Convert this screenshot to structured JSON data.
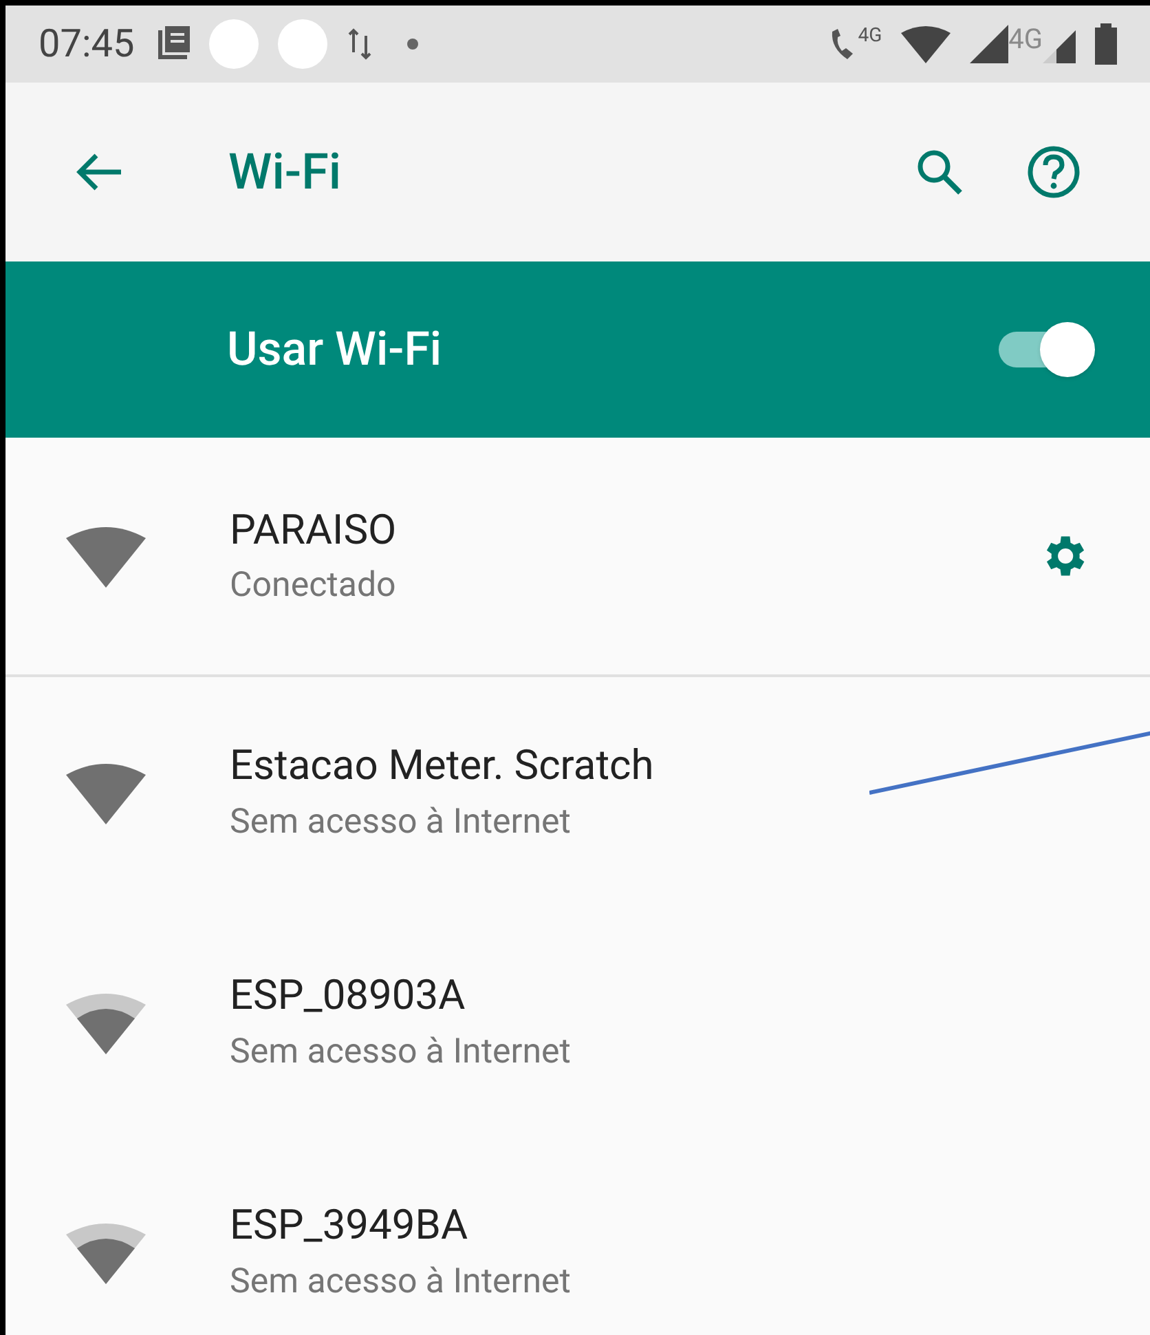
{
  "status_bar": {
    "time": "07:45",
    "call_network": "4G",
    "mobile_network": "4G"
  },
  "toolbar": {
    "title": "Wi-Fi"
  },
  "master_switch": {
    "label": "Usar Wi-Fi",
    "on": true
  },
  "networks": [
    {
      "name": "PARAISO",
      "status": "Conectado",
      "full_signal": true,
      "settings": true
    },
    {
      "name": "Estacao Meter. Scratch",
      "status": "Sem acesso à Internet",
      "full_signal": true,
      "settings": false
    },
    {
      "name": "ESP_08903A",
      "status": "Sem acesso à Internet",
      "full_signal": false,
      "settings": false
    },
    {
      "name": "ESP_3949BA",
      "status": "Sem acesso à Internet",
      "full_signal": false,
      "settings": false
    }
  ]
}
